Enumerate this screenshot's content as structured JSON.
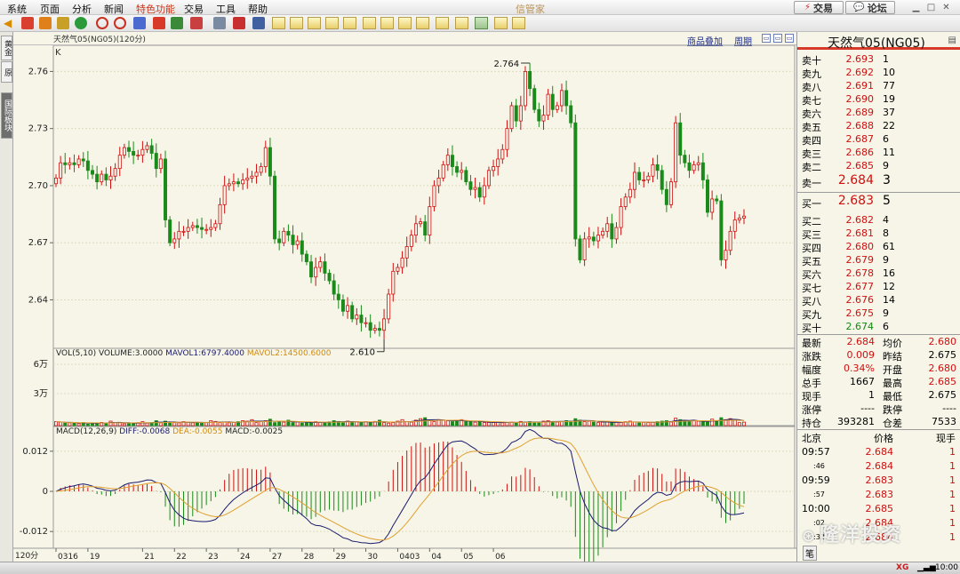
{
  "menu": {
    "items": [
      "系统",
      "页面",
      "分析",
      "新闻",
      "特色功能",
      "交易",
      "工具",
      "帮助"
    ],
    "app_title": "信管家",
    "trade_button": "交易",
    "forum_button": "论坛"
  },
  "sidebar": {
    "tab1": "黄金",
    "tab2": "原",
    "tab3": "国际板块"
  },
  "chart_header": {
    "title": "天然气05(NG05)(120分)",
    "overlay_link": "商品叠加",
    "period_link": "周期"
  },
  "kline": {
    "label": "K",
    "high_label": "2.764",
    "low_label": "2.610",
    "ylim": [
      2.615,
      2.77
    ],
    "yticks": [
      "2.76",
      "2.73",
      "2.70",
      "2.67",
      "2.64"
    ]
  },
  "volume": {
    "legend_title": "VOL(5,10)",
    "legend_volume": "VOLUME:3.0000",
    "legend_mavol1": "MAVOL1:6797.4000",
    "legend_mavol2": "MAVOL2:14500.6000",
    "yticks": [
      "6万",
      "3万"
    ],
    "ymax": 70000
  },
  "macd": {
    "legend_title": "MACD(12,26,9)",
    "legend_diff": "DIFF:-0.0068",
    "legend_dea": "DEA:-0.0055",
    "legend_macd": "MACD:-0.0025",
    "yticks": [
      "0.012",
      "0",
      "-0.012"
    ],
    "ylim": [
      -0.017,
      0.017
    ]
  },
  "x_axis": {
    "period_label": "120分",
    "dates": [
      "0316",
      "19",
      "21",
      "22",
      "23",
      "24",
      "27",
      "28",
      "29",
      "30",
      "0403",
      "04",
      "05",
      "06"
    ],
    "bar_index": [
      0,
      7,
      19,
      26,
      33,
      40,
      47,
      54,
      61,
      68,
      75,
      82,
      89,
      96
    ]
  },
  "chart_data": {
    "type": "candlestick",
    "closes": [
      2.704,
      2.712,
      2.711,
      2.712,
      2.711,
      2.714,
      2.713,
      2.708,
      2.706,
      2.702,
      2.706,
      2.703,
      2.705,
      2.709,
      2.716,
      2.72,
      2.718,
      2.716,
      2.716,
      2.719,
      2.721,
      2.717,
      2.709,
      2.714,
      2.682,
      2.67,
      2.672,
      2.676,
      2.676,
      2.678,
      2.679,
      2.678,
      2.677,
      2.677,
      2.678,
      2.68,
      2.69,
      2.7,
      2.701,
      2.702,
      2.701,
      2.703,
      2.704,
      2.705,
      2.707,
      2.71,
      2.72,
      2.705,
      2.672,
      2.67,
      2.676,
      2.674,
      2.669,
      2.671,
      2.664,
      2.66,
      2.652,
      2.657,
      2.66,
      2.654,
      2.65,
      2.643,
      2.64,
      2.634,
      2.637,
      2.63,
      2.632,
      2.628,
      2.628,
      2.624,
      2.625,
      2.624,
      2.63,
      2.643,
      2.655,
      2.657,
      2.662,
      2.668,
      2.674,
      2.68,
      2.681,
      2.674,
      2.689,
      2.7,
      2.704,
      2.711,
      2.716,
      2.71,
      2.707,
      2.708,
      2.702,
      2.698,
      2.699,
      2.694,
      2.7,
      2.708,
      2.71,
      2.714,
      2.719,
      2.73,
      2.742,
      2.734,
      2.742,
      2.76,
      2.751,
      2.74,
      2.734,
      2.737,
      2.748,
      2.74,
      2.742,
      2.75,
      2.742,
      2.733,
      2.672,
      2.661,
      2.672,
      2.673,
      2.671,
      2.674,
      2.676,
      2.68,
      2.672,
      2.678,
      2.689,
      2.694,
      2.698,
      2.707,
      2.703,
      2.703,
      2.705,
      2.711,
      2.708,
      2.698,
      2.69,
      2.702,
      2.733,
      2.716,
      2.712,
      2.708,
      2.711,
      2.712,
      2.703,
      2.686,
      2.693,
      2.692,
      2.661,
      2.666,
      2.676,
      2.682,
      2.683,
      2.684
    ],
    "volume": [
      4000,
      3500,
      2500,
      2800,
      3000,
      2000,
      3200,
      1500,
      2800,
      2500,
      3200,
      2500,
      4500,
      3000,
      2800,
      1800,
      2500,
      2200,
      3000,
      4000,
      2500,
      3000,
      5000,
      2800,
      4500,
      3200,
      3000,
      2800,
      4000,
      3500,
      2800,
      3200,
      2500,
      3000,
      5000,
      4200,
      3000,
      3500,
      2800,
      3200,
      4000,
      5000,
      4500,
      6000,
      3000,
      4000,
      5000,
      6500,
      3000,
      4000,
      3500,
      5500,
      3000,
      3800,
      2500,
      3000,
      2800,
      4000,
      3500,
      3000,
      3800,
      5000,
      4200,
      3000,
      4500,
      3500,
      4000,
      3200,
      3800,
      3000,
      4200,
      5500,
      3000,
      2500,
      3000,
      4500,
      6000,
      4000,
      3500,
      5500,
      7000,
      8000,
      5000,
      4000,
      6000,
      5500,
      5000,
      4000,
      4500,
      6000,
      4000,
      4500,
      3500,
      3800,
      3000,
      3200,
      3000,
      3500,
      2800,
      3200,
      3500,
      3000,
      4200,
      3500,
      4000,
      3000,
      3500,
      4500,
      5000,
      4200,
      3500,
      4000,
      5000,
      4500,
      7000,
      5500,
      4000,
      4500,
      3500,
      3000,
      3500,
      3800,
      3200,
      3500,
      3000,
      4000,
      4500,
      3500,
      3000,
      3200,
      3000,
      3500,
      4000,
      4500,
      5000,
      3500,
      7500,
      6000,
      5000,
      4000,
      5000,
      4500,
      4000,
      3500,
      6500,
      5000,
      8000,
      6000,
      7000,
      5500,
      3000,
      3500
    ],
    "ma": {
      "diff": "blue",
      "dea": "orange"
    }
  },
  "quote": {
    "title": "天然气05(NG05)",
    "sell": [
      {
        "label": "卖十",
        "price": "2.693",
        "vol": "1"
      },
      {
        "label": "卖九",
        "price": "2.692",
        "vol": "10"
      },
      {
        "label": "卖八",
        "price": "2.691",
        "vol": "77"
      },
      {
        "label": "卖七",
        "price": "2.690",
        "vol": "19"
      },
      {
        "label": "卖六",
        "price": "2.689",
        "vol": "37"
      },
      {
        "label": "卖五",
        "price": "2.688",
        "vol": "22"
      },
      {
        "label": "卖四",
        "price": "2.687",
        "vol": "6"
      },
      {
        "label": "卖三",
        "price": "2.686",
        "vol": "11"
      },
      {
        "label": "卖二",
        "price": "2.685",
        "vol": "9"
      },
      {
        "label": "卖一",
        "price": "2.684",
        "vol": "3"
      }
    ],
    "buy": [
      {
        "label": "买一",
        "price": "2.683",
        "vol": "5"
      },
      {
        "label": "买二",
        "price": "2.682",
        "vol": "4"
      },
      {
        "label": "买三",
        "price": "2.681",
        "vol": "8"
      },
      {
        "label": "买四",
        "price": "2.680",
        "vol": "61"
      },
      {
        "label": "买五",
        "price": "2.679",
        "vol": "9"
      },
      {
        "label": "买六",
        "price": "2.678",
        "vol": "16"
      },
      {
        "label": "买七",
        "price": "2.677",
        "vol": "12"
      },
      {
        "label": "买八",
        "price": "2.676",
        "vol": "14"
      },
      {
        "label": "买九",
        "price": "2.675",
        "vol": "9"
      },
      {
        "label": "买十",
        "price": "2.674",
        "vol": "6"
      }
    ],
    "stats": [
      {
        "l1": "最新",
        "v1": "2.684",
        "c1": "red",
        "l2": "均价",
        "v2": "2.680",
        "c2": "red"
      },
      {
        "l1": "涨跌",
        "v1": "0.009",
        "c1": "red",
        "l2": "昨结",
        "v2": "2.675",
        "c2": ""
      },
      {
        "l1": "幅度",
        "v1": "0.34%",
        "c1": "red",
        "l2": "开盘",
        "v2": "2.680",
        "c2": "red"
      },
      {
        "l1": "总手",
        "v1": "1667",
        "c1": "",
        "l2": "最高",
        "v2": "2.685",
        "c2": "red"
      },
      {
        "l1": "现手",
        "v1": "1",
        "c1": "",
        "l2": "最低",
        "v2": "2.675",
        "c2": ""
      },
      {
        "l1": "涨停",
        "v1": "----",
        "c1": "",
        "l2": "跌停",
        "v2": "----",
        "c2": ""
      },
      {
        "l1": "持仓",
        "v1": "393281",
        "c1": "",
        "l2": "仓差",
        "v2": "7533",
        "c2": ""
      }
    ]
  },
  "trades": {
    "header": {
      "time": "北京",
      "price": "价格",
      "vol": "现手"
    },
    "rows": [
      {
        "time": "09:57",
        "small": false,
        "price": "2.684",
        "vol": "1"
      },
      {
        "time": ":46",
        "small": true,
        "price": "2.684",
        "vol": "1"
      },
      {
        "time": "09:59",
        "small": false,
        "price": "2.683",
        "vol": "1"
      },
      {
        "time": ":57",
        "small": true,
        "price": "2.683",
        "vol": "1"
      },
      {
        "time": "10:00",
        "small": false,
        "price": "2.685",
        "vol": "1"
      },
      {
        "time": ":02",
        "small": true,
        "price": "2.684",
        "vol": "1"
      },
      {
        "time": ":33",
        "small": true,
        "price": "2.684",
        "vol": "1"
      }
    ],
    "footer_tab": "笔"
  },
  "watermark": "隆洋投资",
  "status": {
    "time": "10:00"
  },
  "colors": {
    "up": "#d01010",
    "down": "#1a8a1a",
    "diff": "#1a1a6e",
    "dea": "#e0a030",
    "ma": "#e09020"
  }
}
